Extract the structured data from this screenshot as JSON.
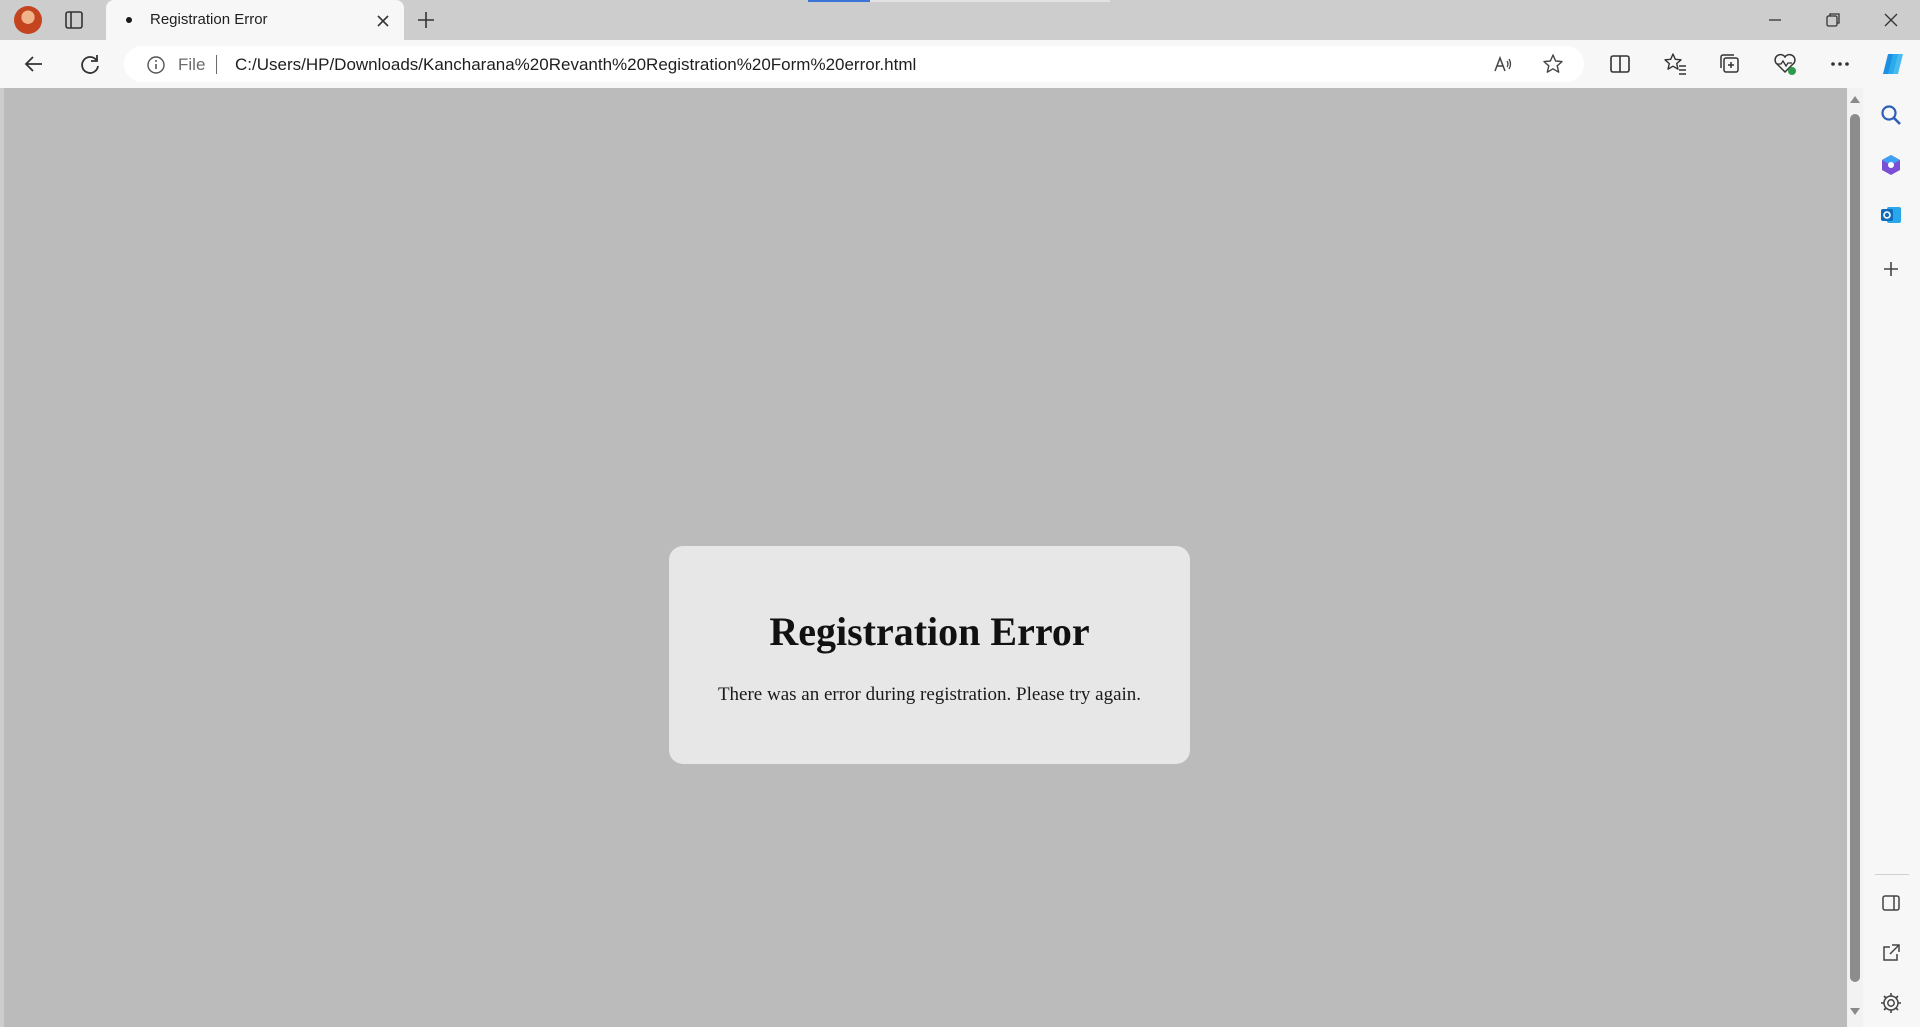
{
  "browser": {
    "tab": {
      "title": "Registration Error"
    },
    "address_bar": {
      "scheme_label": "File",
      "url": "C:/Users/HP/Downloads/Kancharana%20Revanth%20Registration%20Form%20error.html"
    },
    "icons": {
      "profile": "profile-avatar",
      "tab_actions": "tab-actions-icon",
      "close_tab": "close-icon",
      "new_tab": "plus-icon",
      "back": "back-arrow-icon",
      "refresh": "refresh-icon",
      "info": "info-icon",
      "read_aloud": "read-aloud-icon",
      "favorite": "star-icon",
      "split_screen": "split-screen-icon",
      "favorites": "favorites-icon",
      "collections": "collections-icon",
      "browser_essentials": "heart-pulse-icon",
      "more": "more-icon",
      "copilot": "copilot-icon"
    }
  },
  "sidebar": {
    "items": [
      "search-icon",
      "copilot-apps-icon",
      "outlook-icon",
      "add-icon",
      "hide-sidebar-icon",
      "open-external-icon",
      "settings-icon"
    ]
  },
  "page": {
    "background_color": "#bbbbbb",
    "card_color": "#e7e7e7",
    "title": "Registration Error",
    "message": "There was an error during registration. Please try again."
  }
}
